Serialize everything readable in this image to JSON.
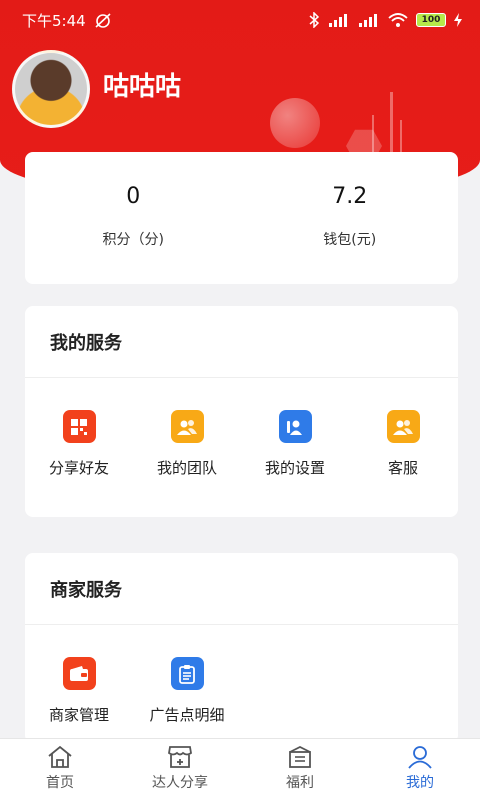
{
  "status": {
    "time": "下午5:44",
    "battery": "100"
  },
  "profile": {
    "name": "咕咕咕"
  },
  "stats": [
    {
      "value": "0",
      "label": "积分（分)"
    },
    {
      "value": "7.2",
      "label": "钱包(元)"
    }
  ],
  "my_services": {
    "title": "我的服务",
    "items": [
      {
        "label": "分享好友",
        "icon": "share-qr-icon",
        "color": "#f2411c"
      },
      {
        "label": "我的团队",
        "icon": "team-icon",
        "color": "#f8a916"
      },
      {
        "label": "我的设置",
        "icon": "settings-user-icon",
        "color": "#2f7be8"
      },
      {
        "label": "客服",
        "icon": "customer-service-icon",
        "color": "#f8a916"
      }
    ]
  },
  "merchant_services": {
    "title": "商家服务",
    "items": [
      {
        "label": "商家管理",
        "icon": "wallet-icon",
        "color": "#f2411c"
      },
      {
        "label": "广告点明细",
        "icon": "clipboard-icon",
        "color": "#2f7be8"
      }
    ]
  },
  "tabs": [
    {
      "label": "首页",
      "icon": "home-icon",
      "active": false
    },
    {
      "label": "达人分享",
      "icon": "shop-icon",
      "active": false
    },
    {
      "label": "福利",
      "icon": "gift-box-icon",
      "active": false
    },
    {
      "label": "我的",
      "icon": "user-icon",
      "active": true
    }
  ],
  "colors": {
    "brand_red": "#e31b17",
    "active_blue": "#2a6bd6"
  }
}
